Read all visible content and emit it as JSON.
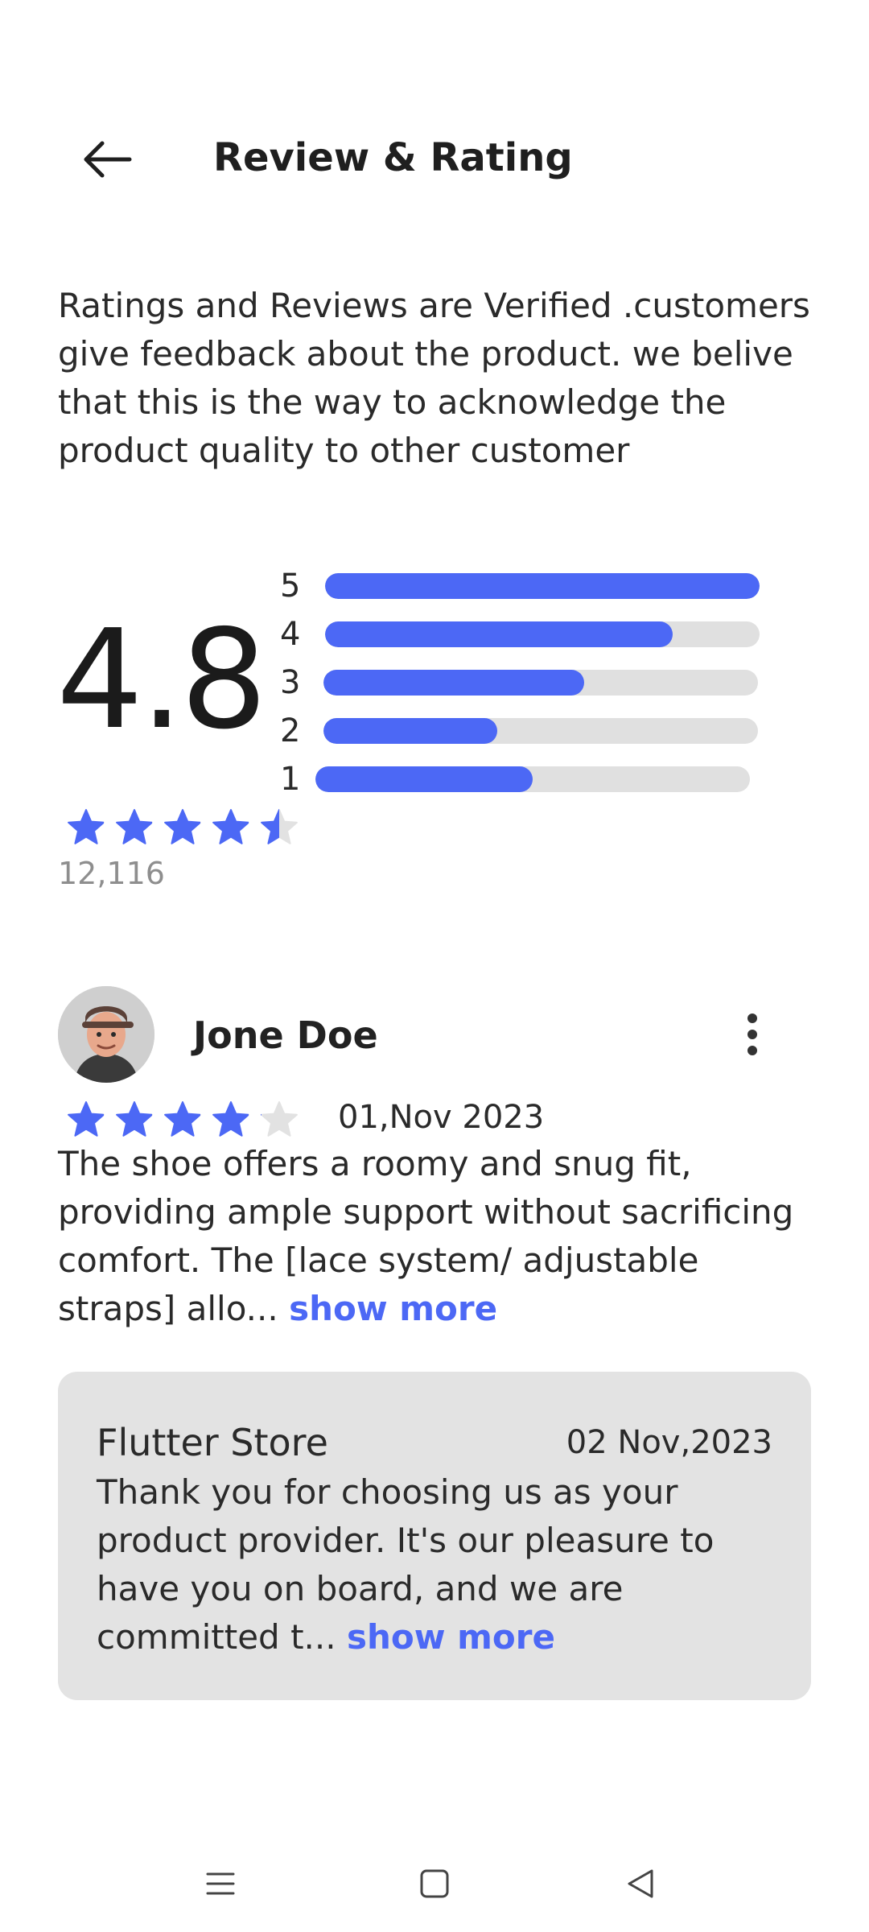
{
  "header": {
    "title": "Review & Rating",
    "back_icon": "arrow-left-icon"
  },
  "intro": {
    "text": "Ratings and Reviews are Verified .customers give feedback about the product. we belive that this is the way to acknowledge the product quality to other customer"
  },
  "summary": {
    "average": "4.8",
    "star_rating": 4.5,
    "count": "12,116",
    "accent_color": "#4c68f5",
    "track_color": "#e0e0e0",
    "bars": [
      {
        "label": "5",
        "fraction": 1.0
      },
      {
        "label": "4",
        "fraction": 0.8
      },
      {
        "label": "3",
        "fraction": 0.6
      },
      {
        "label": "2",
        "fraction": 0.4
      },
      {
        "label": "1",
        "fraction": 0.5
      }
    ]
  },
  "review": {
    "name": "Jone Doe",
    "rating": 4,
    "date": "01,Nov 2023",
    "text": "The shoe offers a roomy and snug fit, providing ample support without sacrificing comfort. The [lace system/ adjustable straps] allo...",
    "show_more": "show more",
    "menu_icon": "more-vertical-icon"
  },
  "reply": {
    "name": "Flutter Store",
    "date": "02 Nov,2023",
    "text": "Thank you for choosing us as your product provider. It's our pleasure to have you on board, and we are committed t...",
    "show_more": "show more",
    "background": "#e3e3e3"
  },
  "navbar": {
    "icons": [
      "menu-icon",
      "home-square-icon",
      "back-triangle-icon"
    ]
  }
}
